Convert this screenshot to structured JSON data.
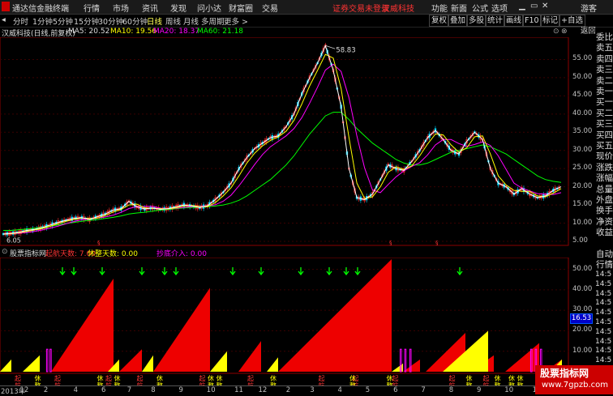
{
  "menubar": {
    "app_title": "通达信金融终端",
    "menus": [
      "行情",
      "市场",
      "资讯",
      "发现",
      "问小达",
      "财富圈",
      "交易"
    ],
    "warning": "证券交易未登录",
    "stock_link": "汉威科技",
    "right_menus": [
      "功能",
      "新面",
      "公式",
      "选项"
    ],
    "guest": "游客"
  },
  "toolbar": {
    "periods": [
      "分时",
      "1分钟",
      "5分钟",
      "15分钟",
      "30分钟",
      "60分钟",
      "日线",
      "周线",
      "月线",
      "多周期",
      "更多 >"
    ],
    "active": "日线",
    "right_buttons": [
      "复权",
      "叠加",
      "多股",
      "统计",
      "画线",
      "F10",
      "标记",
      "+自选",
      "返回"
    ]
  },
  "price_header": {
    "name": "汉威科技(日线,前复权)",
    "ma5": "MA5: 20.52",
    "ma10": "MA10: 19.56",
    "ma20": "MA20: 18.37",
    "ma60": "MA60: 21.18",
    "high_label": "58.83",
    "low_label": "6.05"
  },
  "price_axis": [
    "55.00",
    "50.00",
    "45.00",
    "40.00",
    "35.00",
    "30.00",
    "25.00",
    "20.00",
    "15.00",
    "10.00",
    "5.00"
  ],
  "indicator_header": {
    "name": "股票指标网",
    "qihang": "起航天数: 7.00",
    "xiuzheng": "休整天数: 0.00",
    "chaodi": "抄底介入: 0.00"
  },
  "indicator_axis": [
    "50.00",
    "40.00",
    "30.00",
    "20.00",
    "10.00"
  ],
  "indicator_value": "16.53",
  "side_panel": {
    "labels": [
      "委比",
      "卖五",
      "卖四",
      "卖三",
      "卖二",
      "卖一",
      "买一",
      "买二",
      "买三",
      "买四",
      "买五",
      "现价",
      "涨跌",
      "涨幅",
      "总量",
      "外盘",
      "换手",
      "净资",
      "收益"
    ],
    "auto": "自动",
    "quote": "行情",
    "times": [
      "14:5",
      "14:5",
      "14:5",
      "14:5",
      "14:5",
      "14:5",
      "14:5",
      "14:5",
      "14:5",
      "14:5"
    ]
  },
  "bottom_labels": {
    "qi": [
      "起",
      "航"
    ],
    "xiu": [
      "休",
      "整"
    ]
  },
  "date_axis": [
    "2013年",
    "12",
    "2",
    "4",
    "6",
    "7",
    "8",
    "9",
    "10",
    "11",
    "12",
    "2",
    "3",
    "4",
    "5",
    "6",
    "7",
    "8",
    "9",
    "10",
    "11",
    "12"
  ],
  "watermark": {
    "line1": "股票指标网",
    "line2": "www.7gpzb.com"
  },
  "colors": {
    "up": "#ff0000",
    "down": "#00e0ff",
    "ma5": "#ffffff",
    "ma10": "#ffff00",
    "ma20": "#ff00ff",
    "ma60": "#00ff00",
    "red_fill": "#ee0000",
    "yellow_fill": "#ffff00",
    "arrow": "#00ff00",
    "grid": "#8b0000"
  },
  "chart_data": {
    "type": "line",
    "title": "汉威科技(日线,前复权)",
    "ylim": [
      5,
      60
    ],
    "high": 58.83,
    "low": 6.05,
    "close": [
      7.0,
      7.2,
      7.5,
      8.0,
      8.3,
      8.8,
      9.5,
      10.2,
      10.8,
      11.3,
      11.5,
      11.0,
      11.8,
      12.5,
      13.6,
      14.0,
      16.0,
      14.5,
      13.9,
      14.2,
      13.8,
      14.0,
      14.5,
      15.0,
      14.7,
      14.3,
      14.8,
      16.5,
      18.5,
      21.0,
      25.0,
      28.0,
      30.5,
      32.0,
      33.5,
      34.0,
      36.5,
      40.0,
      45.5,
      50.0,
      54.0,
      58.8,
      52.0,
      42.0,
      25.0,
      17.0,
      16.5,
      18.0,
      22.0,
      26.0,
      25.0,
      24.5,
      27.0,
      30.0,
      33.5,
      35.5,
      33.0,
      30.0,
      29.0,
      32.5,
      35.0,
      33.0,
      25.0,
      21.0,
      20.0,
      18.0,
      19.5,
      18.0,
      17.0,
      17.5,
      19.0,
      20.0
    ],
    "ma60": [
      8.0,
      8.0,
      8.2,
      8.4,
      8.6,
      8.9,
      9.2,
      9.5,
      9.9,
      10.2,
      10.5,
      10.8,
      11.0,
      11.3,
      11.6,
      12.0,
      12.5,
      12.8,
      13.0,
      13.3,
      13.6,
      13.8,
      14.0,
      14.2,
      14.3,
      14.4,
      14.5,
      14.7,
      15.0,
      15.5,
      16.3,
      17.5,
      19.0,
      20.5,
      22.0,
      24.0,
      26.0,
      28.5,
      31.5,
      34.5,
      37.0,
      39.5,
      40.5,
      40.5,
      38.5,
      36.0,
      34.0,
      32.0,
      30.5,
      29.0,
      27.5,
      26.5,
      26.0,
      26.0,
      26.5,
      27.5,
      28.5,
      29.5,
      30.0,
      30.5,
      31.0,
      31.5,
      31.0,
      30.0,
      29.0,
      27.5,
      26.0,
      24.5,
      23.0,
      22.0,
      21.5,
      21.2
    ]
  },
  "indicator_data": {
    "ylim": [
      0,
      55
    ],
    "red_wedges": [
      [
        9,
        20,
        45.5
      ],
      [
        21,
        25,
        11.0
      ],
      [
        27,
        37,
        41.0
      ],
      [
        42,
        46,
        15.0
      ],
      [
        49,
        69,
        55.0
      ],
      [
        71,
        74,
        6.0
      ],
      [
        75,
        82,
        19.0
      ],
      [
        83,
        87,
        8.0
      ],
      [
        89,
        95,
        14.0
      ],
      [
        96,
        99,
        6.0
      ]
    ],
    "yellow_wedges": [
      [
        0,
        2,
        6.0
      ],
      [
        4,
        7,
        8.0
      ],
      [
        19,
        21,
        6.0
      ],
      [
        25,
        27,
        8.0
      ],
      [
        37,
        40,
        10.0
      ],
      [
        47,
        49,
        7.0
      ],
      [
        69,
        71,
        4.0
      ],
      [
        78,
        86,
        20.0
      ],
      [
        97,
        99,
        6.0
      ]
    ],
    "arrows": [
      11,
      13,
      18,
      25,
      29,
      31,
      41,
      46,
      53,
      58,
      61,
      63,
      81
    ]
  }
}
